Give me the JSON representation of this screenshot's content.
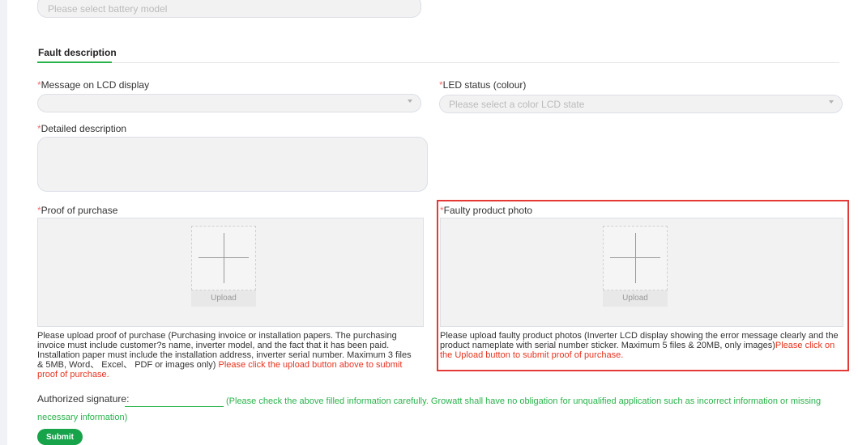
{
  "top": {
    "battery_placeholder": "Please select battery model"
  },
  "section": {
    "title": "Fault description"
  },
  "lcd": {
    "required_mark": "*",
    "label": "Message on LCD display",
    "value": ""
  },
  "led": {
    "required_mark": "*",
    "label": "LED status (colour)",
    "placeholder": "Please select a color LCD state"
  },
  "detail": {
    "required_mark": "*",
    "label": "Detailed description",
    "value": ""
  },
  "proof": {
    "required_mark": "*",
    "label": "Proof of purchase",
    "upload_label": "Upload",
    "help_text": "Please upload proof of purchase (Purchasing invoice or installation papers. The purchasing invoice must include customer?s name, inverter model, and the fact that it has been paid. Installation paper must include the installation address, inverter serial number. Maximum 3 files & 5MB, Word、 Excel、 PDF or images only) ",
    "help_red": "Please click the upload button above to submit proof of purchase."
  },
  "photo": {
    "required_mark": "*",
    "label": "Faulty product photo",
    "upload_label": "Upload",
    "help_text": "Please upload faulty product photos (Inverter LCD display showing the error message clearly and the product nameplate with serial number sticker. Maximum 5 files & 20MB, only images)",
    "help_red": "Please click on the Upload button to submit proof of purchase."
  },
  "signature": {
    "label": "Authorized signature:",
    "value": "",
    "note": "(Please check the above filled information carefully. Growatt shall have no obligation for unqualified application such as incorrect information or missing necessary information)"
  },
  "submit_label": "Submit",
  "colors": {
    "accent_green": "#27b34a",
    "required_red": "#f56c6c",
    "highlight_red": "#e53935"
  }
}
